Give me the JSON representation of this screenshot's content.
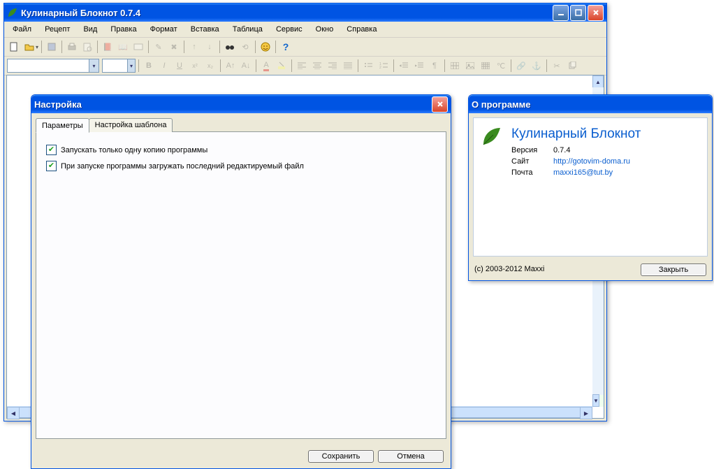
{
  "main": {
    "title": "Кулинарный Блокнот 0.7.4",
    "menus": [
      "Файл",
      "Рецепт",
      "Вид",
      "Правка",
      "Формат",
      "Вставка",
      "Таблица",
      "Сервис",
      "Окно",
      "Справка"
    ]
  },
  "settings": {
    "title": "Настройка",
    "tabs": [
      "Параметры",
      "Настройка шаблона"
    ],
    "opt1": "Запускать только одну копию программы",
    "opt2": "При запуске программы загружать последний редактируемый файл",
    "save": "Сохранить",
    "cancel": "Отмена"
  },
  "about": {
    "title": "О программе",
    "app_name": "Кулинарный Блокнот",
    "rows": {
      "version_k": "Версия",
      "version_v": "0.7.4",
      "site_k": "Сайт",
      "site_v": "http://gotovim-doma.ru",
      "mail_k": "Почта",
      "mail_v": "maxxi165@tut.by"
    },
    "copyright": "(c) 2003-2012 Maxxi",
    "close": "Закрыть"
  }
}
